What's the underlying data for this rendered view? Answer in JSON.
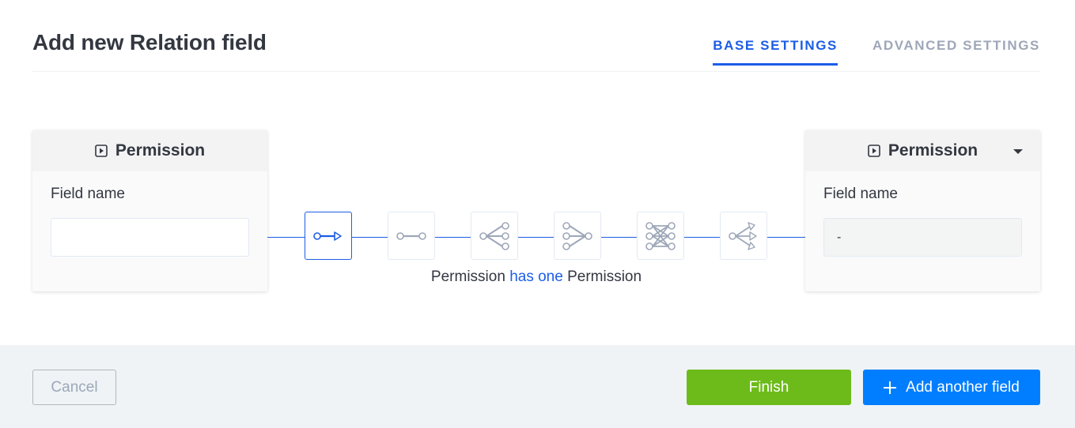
{
  "modal": {
    "title": "Add new Relation field"
  },
  "tabs": [
    {
      "label": "BASE SETTINGS",
      "active": true
    },
    {
      "label": "ADVANCED SETTINGS",
      "active": false
    }
  ],
  "left_card": {
    "content_type": "Permission",
    "field_label": "Field name",
    "field_value": ""
  },
  "right_card": {
    "content_type": "Permission",
    "field_label": "Field name",
    "field_value": "-"
  },
  "relations": [
    {
      "name": "has-one",
      "selected": true
    },
    {
      "name": "one-to-one",
      "selected": false
    },
    {
      "name": "one-to-many",
      "selected": false
    },
    {
      "name": "many-to-one",
      "selected": false
    },
    {
      "name": "many-to-many",
      "selected": false
    },
    {
      "name": "has-many",
      "selected": false
    }
  ],
  "relation_text": {
    "left": "Permission",
    "verb": "has one",
    "right": "Permission"
  },
  "footer": {
    "cancel_label": "Cancel",
    "finish_label": "Finish",
    "add_label": "Add another field"
  },
  "colors": {
    "accent": "#1c5de7",
    "finish": "#6dbb1a",
    "add": "#007eff",
    "icon_gray": "#9ea7b8"
  }
}
